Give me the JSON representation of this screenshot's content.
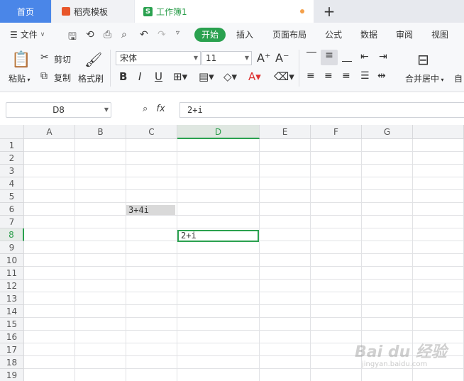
{
  "tabs": {
    "home": "首页",
    "templates": "稻壳模板",
    "workbook": "工作簿1",
    "workbook_icon": "S",
    "add": "+"
  },
  "menu": {
    "file": "文件",
    "start": "开始",
    "insert": "插入",
    "layout": "页面布局",
    "formula": "公式",
    "data": "数据",
    "review": "审阅",
    "view": "视图"
  },
  "ribbon": {
    "paste": "粘贴",
    "cut": "剪切",
    "copy": "复制",
    "format_painter": "格式刷",
    "font_name": "宋体",
    "font_size": "11",
    "merge_center": "合并居中",
    "auto_wrap": "自"
  },
  "formula_bar": {
    "cell_ref": "D8",
    "fx": "fx",
    "value": "2+i"
  },
  "grid": {
    "columns": [
      "A",
      "B",
      "C",
      "D",
      "E",
      "F",
      "G"
    ],
    "rows": [
      "1",
      "2",
      "3",
      "4",
      "5",
      "6",
      "7",
      "8",
      "9",
      "10",
      "11",
      "12",
      "13",
      "14",
      "15",
      "16",
      "17",
      "18",
      "19"
    ],
    "selected_column": "D",
    "selected_row": "8",
    "cells": {
      "C6": "3+4i",
      "D8": "2+i"
    }
  },
  "watermark": {
    "main": "Bai du 经验",
    "sub": "jingyan.baidu.com"
  },
  "colors": {
    "accent": "#2aa14f",
    "home_tab": "#4a86e8"
  }
}
